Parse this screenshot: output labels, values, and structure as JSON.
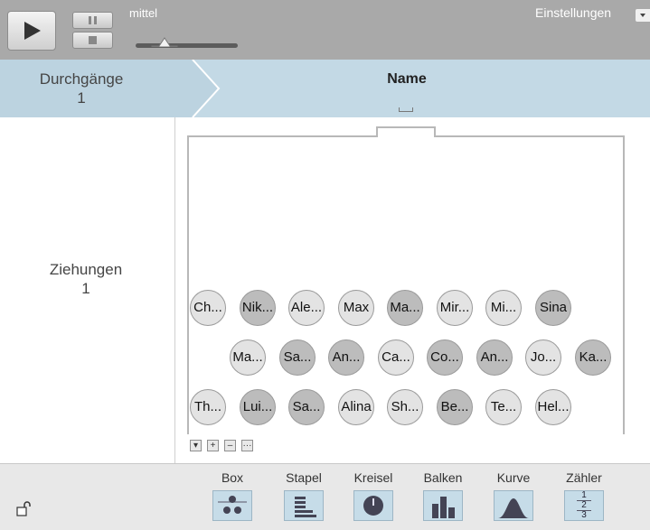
{
  "toolbar": {
    "speed_label": "mittel",
    "settings_label": "Einstellungen"
  },
  "header": {
    "durchgaenge_label": "Durchgänge",
    "durchgaenge_value": "1",
    "column_title": "Name"
  },
  "main": {
    "ziehungen_label": "Ziehungen",
    "ziehungen_value": "1",
    "balls": [
      {
        "label": "Ch...",
        "shade": "light"
      },
      {
        "label": "Nik...",
        "shade": "dark"
      },
      {
        "label": "Ale...",
        "shade": "light"
      },
      {
        "label": "Max",
        "shade": "light"
      },
      {
        "label": "Ma...",
        "shade": "dark"
      },
      {
        "label": "Mir...",
        "shade": "light"
      },
      {
        "label": "Mi...",
        "shade": "light"
      },
      {
        "label": "Sina",
        "shade": "dark"
      },
      {
        "label": "Ma...",
        "shade": "light"
      },
      {
        "label": "Sa...",
        "shade": "dark"
      },
      {
        "label": "An...",
        "shade": "dark"
      },
      {
        "label": "Ca...",
        "shade": "light"
      },
      {
        "label": "Co...",
        "shade": "dark"
      },
      {
        "label": "An...",
        "shade": "dark"
      },
      {
        "label": "Jo...",
        "shade": "light"
      },
      {
        "label": "Ka...",
        "shade": "dark"
      },
      {
        "label": "Th...",
        "shade": "light"
      },
      {
        "label": "Lui...",
        "shade": "dark"
      },
      {
        "label": "Sa...",
        "shade": "dark"
      },
      {
        "label": "Alina",
        "shade": "light"
      },
      {
        "label": "Sh...",
        "shade": "light"
      },
      {
        "label": "Be...",
        "shade": "dark"
      },
      {
        "label": "Te...",
        "shade": "light"
      },
      {
        "label": "Hel...",
        "shade": "light"
      }
    ],
    "box_controls": [
      "▾",
      "+",
      "–",
      "···"
    ]
  },
  "bottom": {
    "tools": [
      "Box",
      "Stapel",
      "Kreisel",
      "Balken",
      "Kurve",
      "Zähler"
    ],
    "counter_digits": [
      "1",
      "2",
      "3"
    ]
  },
  "colors": {
    "toolbar_bg": "#a9a9a9",
    "header_bg": "#c3d9e5",
    "ball_light": "#e3e3e3",
    "ball_dark": "#bcbcbc",
    "bottom_bg": "#e8e8e8"
  }
}
